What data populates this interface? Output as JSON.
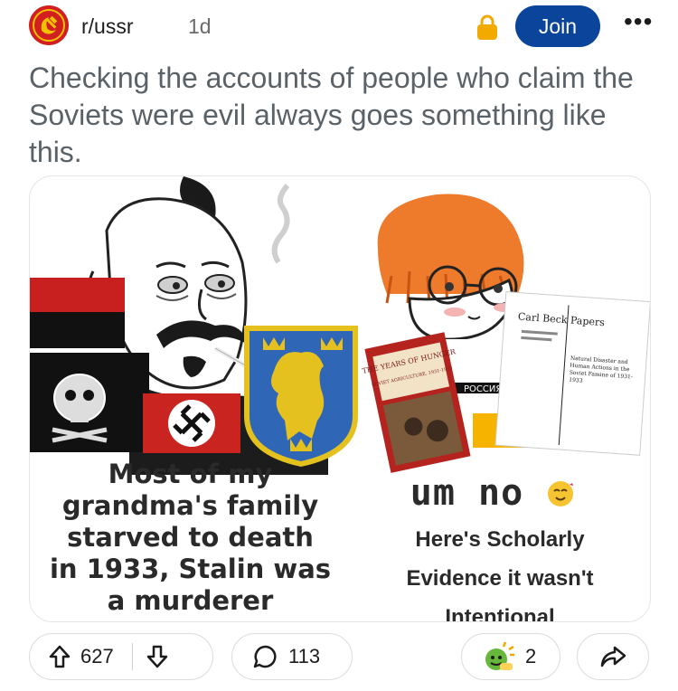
{
  "post": {
    "subreddit": "r/ussr",
    "age": "1d",
    "join_label": "Join",
    "more_label": "•••",
    "title": "Checking the accounts of people who claim the Soviets were evil always goes something like this."
  },
  "meme": {
    "left_caption": [
      "Most of my",
      "grandma's family",
      "starved to death",
      "in 1933, Stalin was",
      "a murderer"
    ],
    "right_caption_top": "um no",
    "right_caption_lines": [
      "Here's Scholarly",
      "Evidence it wasn't",
      "Intentional"
    ],
    "book_title": "THE YEARS OF HUNGER",
    "book_small": "SOVIET AGRICULTURE, 1931-1933",
    "paper_title": "Carl Beck Papers",
    "paper_body": "Natural Disaster and Human Actions in the Soviet Famine of 1931-1933",
    "shirt_text": "РОССИЯ"
  },
  "actions": {
    "upvotes": "627",
    "comments": "113",
    "awards": "2"
  },
  "colors": {
    "join_bg": "#0a449b",
    "avatar_bg": "#d21f1f",
    "lock": "#f2a900",
    "title_text": "#5a6268"
  },
  "icons": [
    "hammer-sickle-icon",
    "lock-icon",
    "upvote-arrow-icon",
    "downvote-arrow-icon",
    "comment-bubble-icon",
    "award-icon",
    "share-icon"
  ]
}
